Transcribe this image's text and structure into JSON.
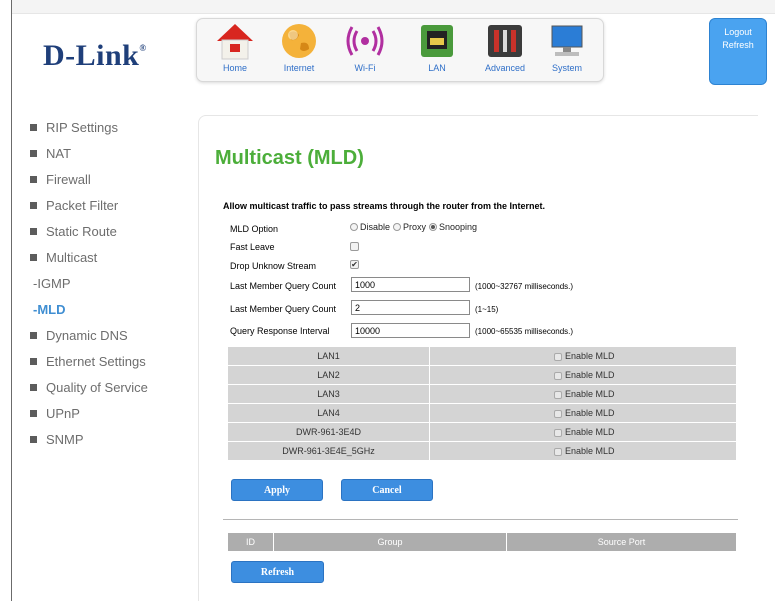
{
  "brand": {
    "logo_text": "D-Link"
  },
  "navbar": {
    "items": [
      {
        "label": "Home",
        "icon": "house-icon"
      },
      {
        "label": "Internet",
        "icon": "globe-icon"
      },
      {
        "label": "Wi-Fi",
        "icon": "wifi-icon"
      },
      {
        "label": "LAN",
        "icon": "ethernet-port-icon"
      },
      {
        "label": "Advanced",
        "icon": "tools-icon"
      },
      {
        "label": "System",
        "icon": "computer-icon"
      }
    ]
  },
  "account": {
    "logout": "Logout",
    "refresh": "Refresh"
  },
  "sidebar": {
    "items": [
      {
        "label": "RIP Settings"
      },
      {
        "label": "NAT"
      },
      {
        "label": "Firewall"
      },
      {
        "label": "Packet Filter"
      },
      {
        "label": "Static Route"
      },
      {
        "label": "Multicast"
      },
      {
        "label": "-IGMP"
      },
      {
        "label": "-MLD"
      },
      {
        "label": "Dynamic DNS"
      },
      {
        "label": "Ethernet Settings"
      },
      {
        "label": "Quality of Service"
      },
      {
        "label": "UPnP"
      },
      {
        "label": "SNMP"
      }
    ]
  },
  "page": {
    "title": "Multicast (MLD)",
    "description": "Allow multicast traffic to pass streams through the router from the Internet."
  },
  "form": {
    "mld_option_label": "MLD Option",
    "options": [
      "Disable",
      "Proxy",
      "Snooping"
    ],
    "selected_option": "Snooping",
    "fast_leave_label": "Fast Leave",
    "fast_leave_checked": false,
    "drop_unknown_label": "Drop Unknow Stream",
    "drop_unknown_checked": true,
    "lmqc1_label": "Last Member Query Count",
    "lmqc1_value": "1000",
    "lmqc1_hint": "(1000~32767 milliseconds.)",
    "lmqc2_label": "Last Member Query Count",
    "lmqc2_value": "2",
    "lmqc2_hint": "(1~15)",
    "qri_label": "Query Response Interval",
    "qri_value": "10000",
    "qri_hint": "(1000~65535 milliseconds.)"
  },
  "lan_ports": [
    {
      "name": "LAN1",
      "enable_label": "Enable MLD",
      "checked": false
    },
    {
      "name": "LAN2",
      "enable_label": "Enable MLD",
      "checked": false
    },
    {
      "name": "LAN3",
      "enable_label": "Enable MLD",
      "checked": false
    },
    {
      "name": "LAN4",
      "enable_label": "Enable MLD",
      "checked": false
    },
    {
      "name": "DWR-961-3E4D",
      "enable_label": "Enable MLD",
      "checked": false
    },
    {
      "name": "DWR-961-3E4E_5GHz",
      "enable_label": "Enable MLD",
      "checked": false
    }
  ],
  "buttons": {
    "apply": "Apply",
    "cancel": "Cancel",
    "refresh": "Refresh"
  },
  "group_table": {
    "columns": [
      "ID",
      "Group",
      "Source Port"
    ]
  },
  "colors": {
    "accent_blue": "#3d8ee0",
    "title_green": "#4cae3a",
    "account_blue": "#4aa3f0",
    "active_sidebar": "#3f8ed2"
  }
}
